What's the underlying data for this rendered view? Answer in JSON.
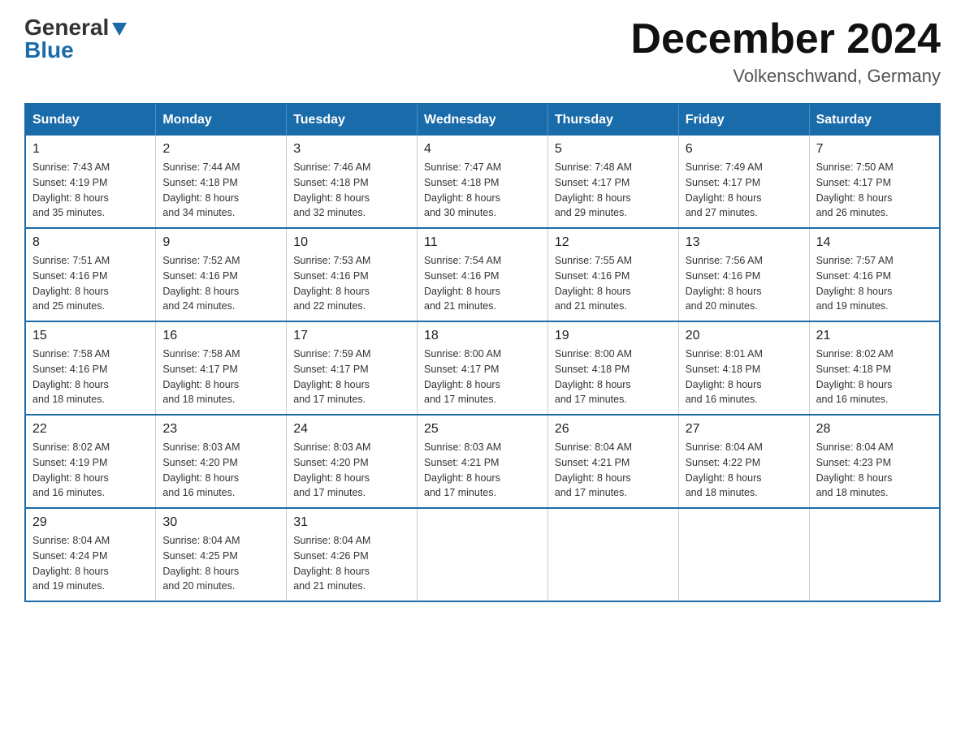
{
  "logo": {
    "general": "General",
    "blue": "Blue"
  },
  "header": {
    "month": "December 2024",
    "location": "Volkenschwand, Germany"
  },
  "weekdays": [
    "Sunday",
    "Monday",
    "Tuesday",
    "Wednesday",
    "Thursday",
    "Friday",
    "Saturday"
  ],
  "weeks": [
    [
      {
        "day": "1",
        "sunrise": "7:43 AM",
        "sunset": "4:19 PM",
        "daylight": "8 hours and 35 minutes."
      },
      {
        "day": "2",
        "sunrise": "7:44 AM",
        "sunset": "4:18 PM",
        "daylight": "8 hours and 34 minutes."
      },
      {
        "day": "3",
        "sunrise": "7:46 AM",
        "sunset": "4:18 PM",
        "daylight": "8 hours and 32 minutes."
      },
      {
        "day": "4",
        "sunrise": "7:47 AM",
        "sunset": "4:18 PM",
        "daylight": "8 hours and 30 minutes."
      },
      {
        "day": "5",
        "sunrise": "7:48 AM",
        "sunset": "4:17 PM",
        "daylight": "8 hours and 29 minutes."
      },
      {
        "day": "6",
        "sunrise": "7:49 AM",
        "sunset": "4:17 PM",
        "daylight": "8 hours and 27 minutes."
      },
      {
        "day": "7",
        "sunrise": "7:50 AM",
        "sunset": "4:17 PM",
        "daylight": "8 hours and 26 minutes."
      }
    ],
    [
      {
        "day": "8",
        "sunrise": "7:51 AM",
        "sunset": "4:16 PM",
        "daylight": "8 hours and 25 minutes."
      },
      {
        "day": "9",
        "sunrise": "7:52 AM",
        "sunset": "4:16 PM",
        "daylight": "8 hours and 24 minutes."
      },
      {
        "day": "10",
        "sunrise": "7:53 AM",
        "sunset": "4:16 PM",
        "daylight": "8 hours and 22 minutes."
      },
      {
        "day": "11",
        "sunrise": "7:54 AM",
        "sunset": "4:16 PM",
        "daylight": "8 hours and 21 minutes."
      },
      {
        "day": "12",
        "sunrise": "7:55 AM",
        "sunset": "4:16 PM",
        "daylight": "8 hours and 21 minutes."
      },
      {
        "day": "13",
        "sunrise": "7:56 AM",
        "sunset": "4:16 PM",
        "daylight": "8 hours and 20 minutes."
      },
      {
        "day": "14",
        "sunrise": "7:57 AM",
        "sunset": "4:16 PM",
        "daylight": "8 hours and 19 minutes."
      }
    ],
    [
      {
        "day": "15",
        "sunrise": "7:58 AM",
        "sunset": "4:16 PM",
        "daylight": "8 hours and 18 minutes."
      },
      {
        "day": "16",
        "sunrise": "7:58 AM",
        "sunset": "4:17 PM",
        "daylight": "8 hours and 18 minutes."
      },
      {
        "day": "17",
        "sunrise": "7:59 AM",
        "sunset": "4:17 PM",
        "daylight": "8 hours and 17 minutes."
      },
      {
        "day": "18",
        "sunrise": "8:00 AM",
        "sunset": "4:17 PM",
        "daylight": "8 hours and 17 minutes."
      },
      {
        "day": "19",
        "sunrise": "8:00 AM",
        "sunset": "4:18 PM",
        "daylight": "8 hours and 17 minutes."
      },
      {
        "day": "20",
        "sunrise": "8:01 AM",
        "sunset": "4:18 PM",
        "daylight": "8 hours and 16 minutes."
      },
      {
        "day": "21",
        "sunrise": "8:02 AM",
        "sunset": "4:18 PM",
        "daylight": "8 hours and 16 minutes."
      }
    ],
    [
      {
        "day": "22",
        "sunrise": "8:02 AM",
        "sunset": "4:19 PM",
        "daylight": "8 hours and 16 minutes."
      },
      {
        "day": "23",
        "sunrise": "8:03 AM",
        "sunset": "4:20 PM",
        "daylight": "8 hours and 16 minutes."
      },
      {
        "day": "24",
        "sunrise": "8:03 AM",
        "sunset": "4:20 PM",
        "daylight": "8 hours and 17 minutes."
      },
      {
        "day": "25",
        "sunrise": "8:03 AM",
        "sunset": "4:21 PM",
        "daylight": "8 hours and 17 minutes."
      },
      {
        "day": "26",
        "sunrise": "8:04 AM",
        "sunset": "4:21 PM",
        "daylight": "8 hours and 17 minutes."
      },
      {
        "day": "27",
        "sunrise": "8:04 AM",
        "sunset": "4:22 PM",
        "daylight": "8 hours and 18 minutes."
      },
      {
        "day": "28",
        "sunrise": "8:04 AM",
        "sunset": "4:23 PM",
        "daylight": "8 hours and 18 minutes."
      }
    ],
    [
      {
        "day": "29",
        "sunrise": "8:04 AM",
        "sunset": "4:24 PM",
        "daylight": "8 hours and 19 minutes."
      },
      {
        "day": "30",
        "sunrise": "8:04 AM",
        "sunset": "4:25 PM",
        "daylight": "8 hours and 20 minutes."
      },
      {
        "day": "31",
        "sunrise": "8:04 AM",
        "sunset": "4:26 PM",
        "daylight": "8 hours and 21 minutes."
      },
      null,
      null,
      null,
      null
    ]
  ],
  "labels": {
    "sunrise": "Sunrise:",
    "sunset": "Sunset:",
    "daylight": "Daylight:"
  }
}
